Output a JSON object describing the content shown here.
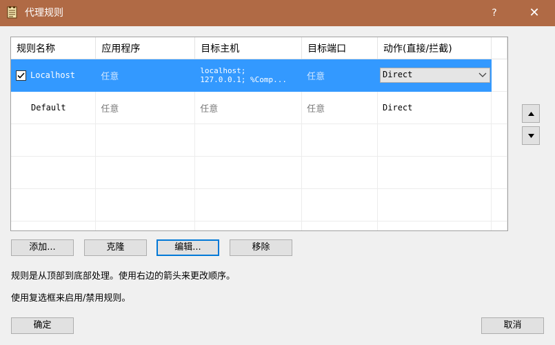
{
  "window": {
    "title": "代理规则",
    "help": "?",
    "close": "✕"
  },
  "table": {
    "columns": [
      "规则名称",
      "应用程序",
      "目标主机",
      "目标端口",
      "动作(直接/拦截)"
    ],
    "rows": [
      {
        "name": "Localhost",
        "checked": true,
        "app": "任意",
        "host_line1": "localhost;",
        "host_line2": "127.0.0.1; %Comp...",
        "port": "任意",
        "action": "Direct"
      },
      {
        "name": "Default",
        "checked": false,
        "app": "任意",
        "host": "任意",
        "port": "任意",
        "action": "Direct"
      }
    ]
  },
  "buttons": {
    "add": "添加...",
    "clone": "克隆",
    "edit": "编辑...",
    "remove": "移除",
    "ok": "确定",
    "cancel": "取消"
  },
  "info": {
    "line1": "规则是从顶部到底部处理。使用右边的箭头来更改顺序。",
    "line2": "使用复选框来启用/禁用规则。"
  },
  "colors": {
    "titlebar": "#b06a45",
    "selection": "#3399ff",
    "focus_border": "#0078d7"
  },
  "icons": {
    "app": "app-document-icon",
    "up": "arrow-up-icon",
    "down": "arrow-down-icon"
  }
}
